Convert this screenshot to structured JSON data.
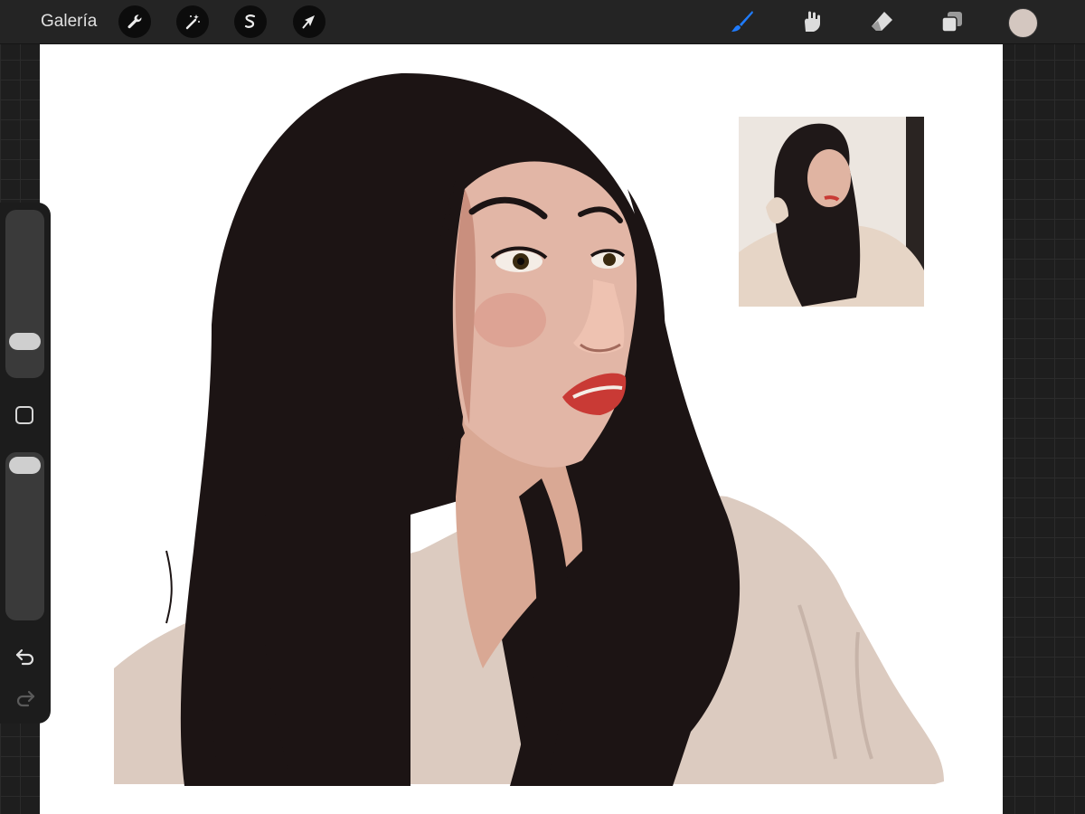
{
  "topbar": {
    "gallery_label": "Galería",
    "left_tools": [
      "wrench-icon",
      "magic-wand-icon",
      "selection-icon",
      "transform-arrow-icon"
    ],
    "right_tools": [
      "brush-icon",
      "smudge-icon",
      "eraser-icon",
      "layers-icon"
    ],
    "active_tool": "brush-icon"
  },
  "colors": {
    "active_tool": "#1f7cff",
    "current_color": "#d4c7c0",
    "canvas_bg": "#ffffff",
    "hair": "#1c1414",
    "skin": "#e2b6a6",
    "sweater": "#dccbc0",
    "lips": "#c93a35"
  },
  "sidebar": {
    "brush_size_level": 0.3,
    "opacity_level": 0.05,
    "tools": [
      "modify-square-icon",
      "undo-icon",
      "redo-icon"
    ]
  }
}
